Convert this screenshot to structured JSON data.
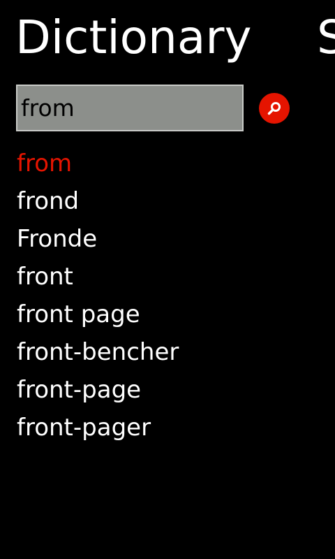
{
  "header": {
    "title": "Dictionary",
    "next_title_peek": "S"
  },
  "search": {
    "value": "from",
    "placeholder": ""
  },
  "results": [
    "from",
    "frond",
    "Fronde",
    "front",
    "front page",
    "front-bencher",
    "front-page",
    "front-pager"
  ],
  "colors": {
    "accent": "#e51400",
    "background": "#000000",
    "text": "#ffffff",
    "input_background": "#8c8f8b",
    "input_border": "#c9cbc8"
  },
  "icons": {
    "search_button": "search-icon"
  }
}
